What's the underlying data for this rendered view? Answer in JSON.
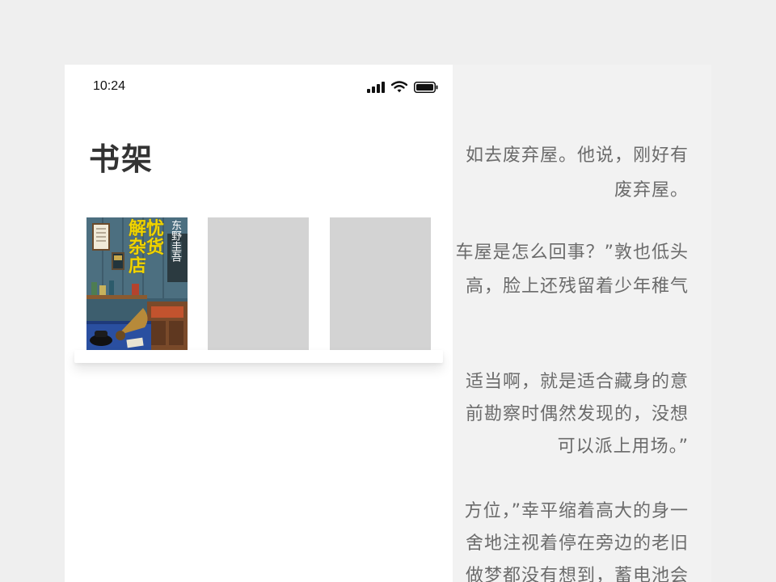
{
  "reader": {
    "lines": [
      "如去废弃屋。他说，刚好有",
      "废弃屋。",
      "车屋是怎么回事？”敦也低头",
      "高，脸上还残留着少年稚气",
      "适当啊，就是适合藏身的意",
      "前勘察时偶然发现的，没想",
      "可以派上用场。”",
      "方位，”幸平缩着高大的身一",
      "舍地注视着停在旁边的老旧",
      "做梦都没有想到，蓄电池会"
    ]
  },
  "status_bar": {
    "time": "10:24"
  },
  "shelf": {
    "title": "书架",
    "books": [
      {
        "title_chars": [
          "解",
          "忧",
          "杂",
          "货",
          "店"
        ],
        "author": "东野圭吾"
      }
    ]
  },
  "colors": {
    "background": "#efefef",
    "panel": "#ffffff",
    "placeholder": "#d3d3d3",
    "reader_text": "#6b6b6b",
    "title_text": "#333333",
    "cover_title": "#f0d400"
  }
}
